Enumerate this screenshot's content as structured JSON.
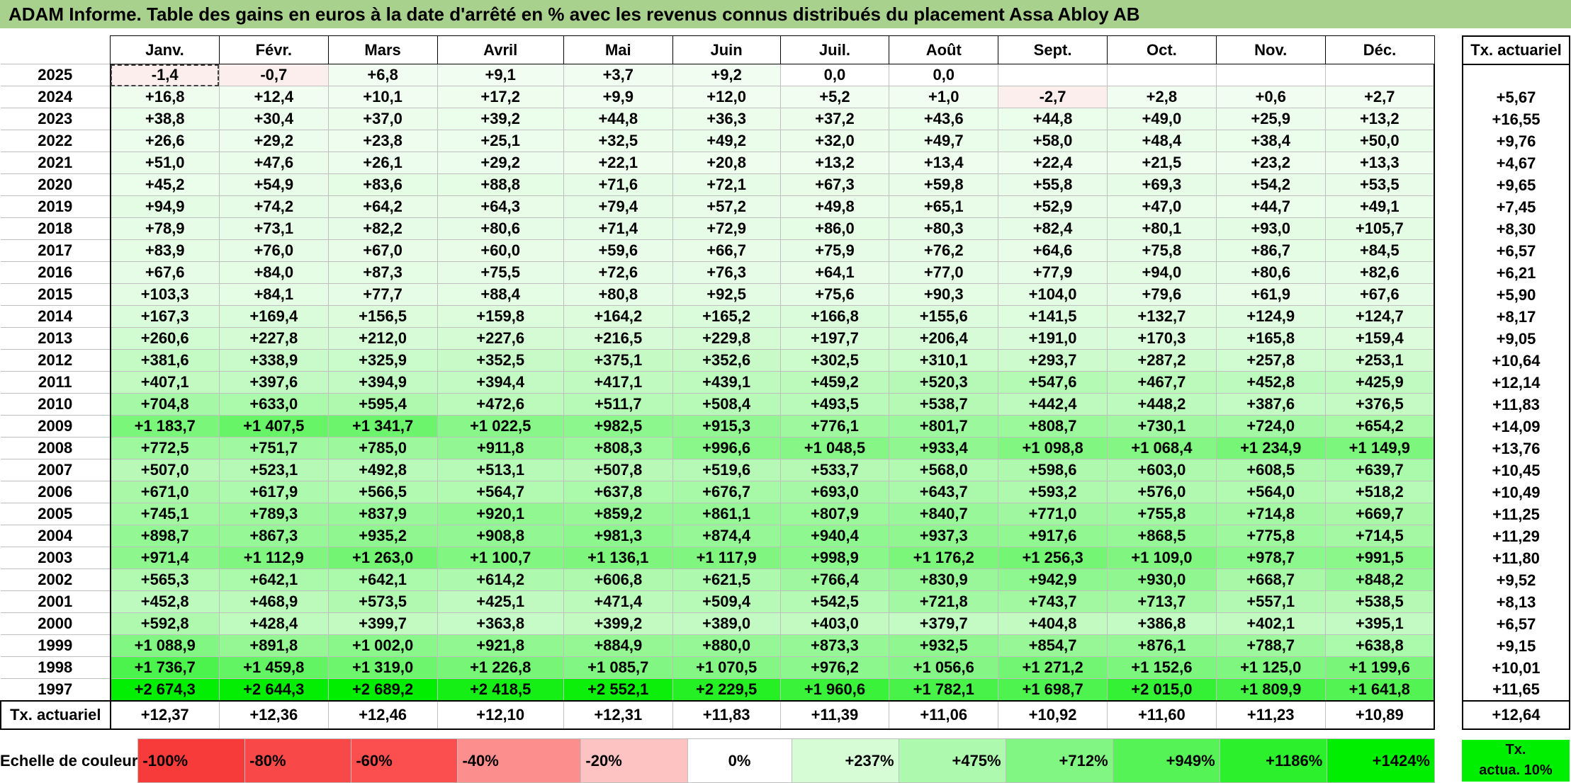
{
  "title": "ADAM Informe. Table des gains en euros à la date d'arrêté en % avec les revenus connus distribués du placement Assa Abloy AB",
  "months": [
    "Janv.",
    "Févr.",
    "Mars",
    "Avril",
    "Mai",
    "Juin",
    "Juil.",
    "Août",
    "Sept.",
    "Oct.",
    "Nov.",
    "Déc."
  ],
  "rate_header": "Tx. actuariel",
  "rows": [
    {
      "year": "2025",
      "values": [
        "-1,4",
        "-0,7",
        "+6,8",
        "+9,1",
        "+3,7",
        "+9,2",
        "0,0",
        "0,0",
        "",
        "",
        "",
        ""
      ],
      "rate": ""
    },
    {
      "year": "2024",
      "values": [
        "+16,8",
        "+12,4",
        "+10,1",
        "+17,2",
        "+9,9",
        "+12,0",
        "+5,2",
        "+1,0",
        "-2,7",
        "+2,8",
        "+0,6",
        "+2,7"
      ],
      "rate": "+5,67"
    },
    {
      "year": "2023",
      "values": [
        "+38,8",
        "+30,4",
        "+37,0",
        "+39,2",
        "+44,8",
        "+36,3",
        "+37,2",
        "+43,6",
        "+44,8",
        "+49,0",
        "+25,9",
        "+13,2"
      ],
      "rate": "+16,55"
    },
    {
      "year": "2022",
      "values": [
        "+26,6",
        "+29,2",
        "+23,8",
        "+25,1",
        "+32,5",
        "+49,2",
        "+32,0",
        "+49,7",
        "+58,0",
        "+48,4",
        "+38,4",
        "+50,0"
      ],
      "rate": "+9,76"
    },
    {
      "year": "2021",
      "values": [
        "+51,0",
        "+47,6",
        "+26,1",
        "+29,2",
        "+22,1",
        "+20,8",
        "+13,2",
        "+13,4",
        "+22,4",
        "+21,5",
        "+23,2",
        "+13,3"
      ],
      "rate": "+4,67"
    },
    {
      "year": "2020",
      "values": [
        "+45,2",
        "+54,9",
        "+83,6",
        "+88,8",
        "+71,6",
        "+72,1",
        "+67,3",
        "+59,8",
        "+55,8",
        "+69,3",
        "+54,2",
        "+53,5"
      ],
      "rate": "+9,65"
    },
    {
      "year": "2019",
      "values": [
        "+94,9",
        "+74,2",
        "+64,2",
        "+64,3",
        "+79,4",
        "+57,2",
        "+49,8",
        "+65,1",
        "+52,9",
        "+47,0",
        "+44,7",
        "+49,1"
      ],
      "rate": "+7,45"
    },
    {
      "year": "2018",
      "values": [
        "+78,9",
        "+73,1",
        "+82,2",
        "+80,6",
        "+71,4",
        "+72,9",
        "+86,0",
        "+80,3",
        "+82,4",
        "+80,1",
        "+93,0",
        "+105,7"
      ],
      "rate": "+8,30"
    },
    {
      "year": "2017",
      "values": [
        "+83,9",
        "+76,0",
        "+67,0",
        "+60,0",
        "+59,6",
        "+66,7",
        "+75,9",
        "+76,2",
        "+64,6",
        "+75,8",
        "+86,7",
        "+84,5"
      ],
      "rate": "+6,57"
    },
    {
      "year": "2016",
      "values": [
        "+67,6",
        "+84,0",
        "+87,3",
        "+75,5",
        "+72,6",
        "+76,3",
        "+64,1",
        "+77,0",
        "+77,9",
        "+94,0",
        "+80,6",
        "+82,6"
      ],
      "rate": "+6,21"
    },
    {
      "year": "2015",
      "values": [
        "+103,3",
        "+84,1",
        "+77,7",
        "+88,4",
        "+80,8",
        "+92,5",
        "+75,6",
        "+90,3",
        "+104,0",
        "+79,6",
        "+61,9",
        "+67,6"
      ],
      "rate": "+5,90"
    },
    {
      "year": "2014",
      "values": [
        "+167,3",
        "+169,4",
        "+156,5",
        "+159,8",
        "+164,2",
        "+165,2",
        "+166,8",
        "+155,6",
        "+141,5",
        "+132,7",
        "+124,9",
        "+124,7"
      ],
      "rate": "+8,17"
    },
    {
      "year": "2013",
      "values": [
        "+260,6",
        "+227,8",
        "+212,0",
        "+227,6",
        "+216,5",
        "+229,8",
        "+197,7",
        "+206,4",
        "+191,0",
        "+170,3",
        "+165,8",
        "+159,4"
      ],
      "rate": "+9,05"
    },
    {
      "year": "2012",
      "values": [
        "+381,6",
        "+338,9",
        "+325,9",
        "+352,5",
        "+375,1",
        "+352,6",
        "+302,5",
        "+310,1",
        "+293,7",
        "+287,2",
        "+257,8",
        "+253,1"
      ],
      "rate": "+10,64"
    },
    {
      "year": "2011",
      "values": [
        "+407,1",
        "+397,6",
        "+394,9",
        "+394,4",
        "+417,1",
        "+439,1",
        "+459,2",
        "+520,3",
        "+547,6",
        "+467,7",
        "+452,8",
        "+425,9"
      ],
      "rate": "+12,14"
    },
    {
      "year": "2010",
      "values": [
        "+704,8",
        "+633,0",
        "+595,4",
        "+472,6",
        "+511,7",
        "+508,4",
        "+493,5",
        "+538,7",
        "+442,4",
        "+448,2",
        "+387,6",
        "+376,5"
      ],
      "rate": "+11,83"
    },
    {
      "year": "2009",
      "values": [
        "+1 183,7",
        "+1 407,5",
        "+1 341,7",
        "+1 022,5",
        "+982,5",
        "+915,3",
        "+776,1",
        "+801,7",
        "+808,7",
        "+730,1",
        "+724,0",
        "+654,2"
      ],
      "rate": "+14,09"
    },
    {
      "year": "2008",
      "values": [
        "+772,5",
        "+751,7",
        "+785,0",
        "+911,8",
        "+808,3",
        "+996,6",
        "+1 048,5",
        "+933,4",
        "+1 098,8",
        "+1 068,4",
        "+1 234,9",
        "+1 149,9"
      ],
      "rate": "+13,76"
    },
    {
      "year": "2007",
      "values": [
        "+507,0",
        "+523,1",
        "+492,8",
        "+513,1",
        "+507,8",
        "+519,6",
        "+533,7",
        "+568,0",
        "+598,6",
        "+603,0",
        "+608,5",
        "+639,7"
      ],
      "rate": "+10,45"
    },
    {
      "year": "2006",
      "values": [
        "+671,0",
        "+617,9",
        "+566,5",
        "+564,7",
        "+637,8",
        "+676,7",
        "+693,0",
        "+643,7",
        "+593,2",
        "+576,0",
        "+564,0",
        "+518,2"
      ],
      "rate": "+10,49"
    },
    {
      "year": "2005",
      "values": [
        "+745,1",
        "+789,3",
        "+837,9",
        "+920,1",
        "+859,2",
        "+861,1",
        "+807,9",
        "+840,7",
        "+771,0",
        "+755,8",
        "+714,8",
        "+669,7"
      ],
      "rate": "+11,25"
    },
    {
      "year": "2004",
      "values": [
        "+898,7",
        "+867,3",
        "+935,2",
        "+908,8",
        "+981,3",
        "+874,4",
        "+940,4",
        "+937,3",
        "+917,6",
        "+868,5",
        "+775,8",
        "+714,5"
      ],
      "rate": "+11,29"
    },
    {
      "year": "2003",
      "values": [
        "+971,4",
        "+1 112,9",
        "+1 263,0",
        "+1 100,7",
        "+1 136,1",
        "+1 117,9",
        "+998,9",
        "+1 176,2",
        "+1 256,3",
        "+1 109,0",
        "+978,7",
        "+991,5"
      ],
      "rate": "+11,80"
    },
    {
      "year": "2002",
      "values": [
        "+565,3",
        "+642,1",
        "+642,1",
        "+614,2",
        "+606,8",
        "+621,5",
        "+766,4",
        "+830,9",
        "+942,9",
        "+930,0",
        "+668,7",
        "+848,2"
      ],
      "rate": "+9,52"
    },
    {
      "year": "2001",
      "values": [
        "+452,8",
        "+468,9",
        "+573,5",
        "+425,1",
        "+471,4",
        "+509,4",
        "+542,5",
        "+721,8",
        "+743,7",
        "+713,7",
        "+557,1",
        "+538,5"
      ],
      "rate": "+8,13"
    },
    {
      "year": "2000",
      "values": [
        "+592,8",
        "+428,4",
        "+399,7",
        "+363,8",
        "+399,2",
        "+389,0",
        "+403,0",
        "+379,7",
        "+404,8",
        "+386,8",
        "+402,1",
        "+395,1"
      ],
      "rate": "+6,57"
    },
    {
      "year": "1999",
      "values": [
        "+1 088,9",
        "+891,8",
        "+1 002,0",
        "+921,8",
        "+884,9",
        "+880,0",
        "+873,3",
        "+932,5",
        "+854,7",
        "+876,1",
        "+788,7",
        "+638,8"
      ],
      "rate": "+9,15"
    },
    {
      "year": "1998",
      "values": [
        "+1 736,7",
        "+1 459,8",
        "+1 319,0",
        "+1 226,8",
        "+1 085,7",
        "+1 070,5",
        "+976,2",
        "+1 056,6",
        "+1 271,2",
        "+1 152,6",
        "+1 125,0",
        "+1 199,6"
      ],
      "rate": "+10,01"
    },
    {
      "year": "1997",
      "values": [
        "+2 674,3",
        "+2 644,3",
        "+2 689,2",
        "+2 418,5",
        "+2 552,1",
        "+2 229,5",
        "+1 960,6",
        "+1 782,1",
        "+1 698,7",
        "+2 015,0",
        "+1 809,9",
        "+1 641,8"
      ],
      "rate": "+11,65"
    }
  ],
  "rate_row": {
    "label": "Tx. actuariel",
    "values": [
      "+12,37",
      "+12,36",
      "+12,46",
      "+12,10",
      "+12,31",
      "+11,83",
      "+11,39",
      "+11,06",
      "+10,92",
      "+11,60",
      "+11,23",
      "+10,89"
    ],
    "total": "+12,64"
  },
  "scale": {
    "label": "Echelle de couleur",
    "items": [
      {
        "label": "-100%",
        "color": "#f73a3a"
      },
      {
        "label": "-80%",
        "color": "#f84848"
      },
      {
        "label": "-60%",
        "color": "#fb4f4f"
      },
      {
        "label": "-40%",
        "color": "#fc8e8e"
      },
      {
        "label": "-20%",
        "color": "#fdc2c2"
      },
      {
        "label": "0%",
        "color": "#ffffff"
      },
      {
        "label": "+237%",
        "color": "#d6fcd6"
      },
      {
        "label": "+475%",
        "color": "#adf9ad"
      },
      {
        "label": "+712%",
        "color": "#82f682"
      },
      {
        "label": "+949%",
        "color": "#56f356"
      },
      {
        "label": "+1186%",
        "color": "#2bf02b"
      },
      {
        "label": "+1424%",
        "color": "#00ee00"
      }
    ],
    "rate_box_line1": "Tx.",
    "rate_box_line2": "actua. 10%"
  },
  "colors": {
    "title_bar": "#a9d18e",
    "negative": "#fdeeee",
    "positive_max": "#00ee00",
    "white": "#ffffff"
  }
}
